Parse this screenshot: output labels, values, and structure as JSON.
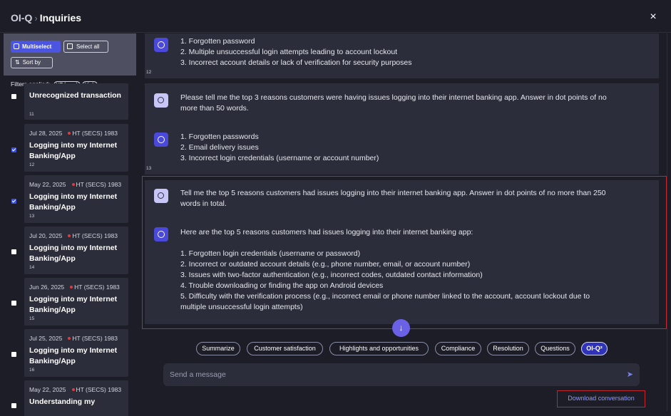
{
  "header": {
    "app": "OI-Q",
    "separator": "›",
    "page": "Inquiries",
    "close": "×"
  },
  "sidebar": {
    "multiselect": "Multiselect",
    "select_all": "Select all",
    "sort_by": "Sort by",
    "filters_label": "Filters applied:",
    "filter_chips": [
      "HT (secs)",
      "High"
    ],
    "items": [
      {
        "title": "Unrecognized transaction",
        "index": "11",
        "checked": false
      },
      {
        "date": "Jul 28, 2025",
        "tag": "HT (SECS) 1983",
        "title": "Logging into my Internet Banking/App",
        "index": "12",
        "checked": true
      },
      {
        "date": "May 22, 2025",
        "tag": "HT (SECS) 1983",
        "title": "Logging into my Internet Banking/App",
        "index": "13",
        "checked": true
      },
      {
        "date": "Jul 20, 2025",
        "tag": "HT (SECS) 1983",
        "title": "Logging into my Internet Banking/App",
        "index": "14",
        "checked": false
      },
      {
        "date": "Jun 26, 2025",
        "tag": "HT (SECS) 1983",
        "title": "Logging into my Internet Banking/App",
        "index": "15",
        "checked": false
      },
      {
        "date": "Jul 25, 2025",
        "tag": "HT (SECS) 1983",
        "title": "Logging into my Internet Banking/App",
        "index": "16",
        "checked": false
      },
      {
        "date": "May 22, 2025",
        "tag": "HT (SECS) 1983",
        "title": "Understanding my",
        "checked": false
      }
    ]
  },
  "conversation": {
    "block12": {
      "lines": [
        "1. Forgotten password",
        "2. Multiple unsuccessful login attempts leading to account lockout",
        "3. Incorrect account details or lack of verification for security purposes"
      ],
      "index": "12"
    },
    "block13_question": [
      "Please tell me the top 3 reasons customers were having issues logging into their internet banking app. Answer in dot points of no",
      "more than 50 words."
    ],
    "block13_answer": [
      "1. Forgotten passwords",
      "2. Email delivery issues",
      "3. Incorrect login credentials (username or account number)"
    ],
    "block13_index": "13",
    "highlight_question": [
      "Tell me the top 5 reasons customers had issues logging into their internet banking app. Answer in dot points of no more than 250",
      "words in total."
    ],
    "highlight_answer": [
      "Here are the top 5 reasons customers had issues logging into their internet banking app:",
      "",
      "1. Forgotten login credentials (username or password)",
      "2. Incorrect or outdated account details (e.g., phone number, email, or account number)",
      "3. Issues with two-factor authentication (e.g., incorrect codes, outdated contact information)",
      "4. Trouble downloading or finding the app on Android devices",
      "5. Difficulty with the verification process (e.g., incorrect email or phone number linked to the account, account lockout due to",
      "multiple unsuccessful login attempts)"
    ]
  },
  "chips": [
    "Summarize",
    "Customer satisfaction",
    "Highlights and opportunities",
    "Compliance",
    "Resolution",
    "Questions",
    "OI-Q²"
  ],
  "composer": {
    "placeholder": "Send a message",
    "send_icon": "send-icon"
  },
  "download": "Download conversation",
  "colors": {
    "accent": "#4b55e0",
    "highlight_border": "#c0262c",
    "status_dot": "#e23b3b"
  }
}
